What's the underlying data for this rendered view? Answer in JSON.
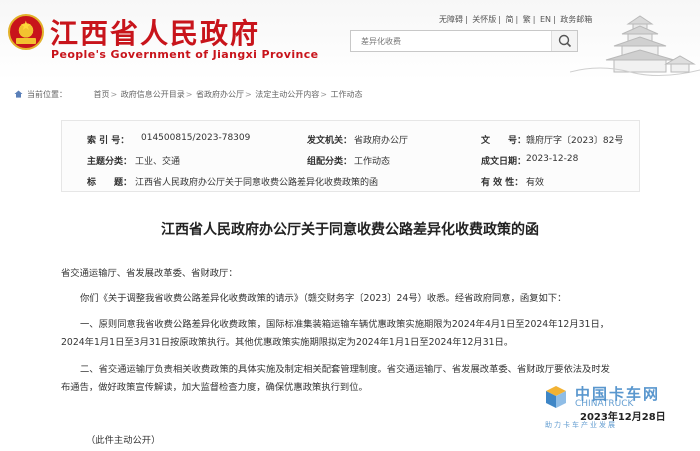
{
  "header": {
    "site_title_cn": "江西省人民政府",
    "site_title_en": "People's Government of Jiangxi Province",
    "top_links": [
      "无障碍",
      "关怀版",
      "简",
      "繁",
      "EN",
      "政务邮箱"
    ],
    "search_placeholder": "差异化收费"
  },
  "breadcrumb": {
    "label": "当前位置：",
    "items": [
      "首页",
      "政府信息公开目录",
      "省政府办公厅",
      "法定主动公开内容",
      "工作动态"
    ]
  },
  "meta": {
    "index_label": "索 引 号：",
    "index_value": "014500815/2023-78309",
    "issuer_label": "发文机关：",
    "issuer_value": "省政府办公厅",
    "docno_label": "文　　号：",
    "docno_value": "赣府厅字〔2023〕82号",
    "topic_label": "主题分类：",
    "topic_value": "工业、交通",
    "category_label": "组配分类：",
    "category_value": "工作动态",
    "date_label": "成文日期：",
    "date_value": "2023-12-28",
    "title_label": "标　　题：",
    "title_value": "江西省人民政府办公厅关于同意收费公路差异化收费政策的函",
    "validity_label": "有 效 性：",
    "validity_value": "有效"
  },
  "doc": {
    "title": "江西省人民政府办公厅关于同意收费公路差异化收费政策的函",
    "addressee": "省交通运输厅、省发展改革委、省财政厅：",
    "p1": "你们《关于调整我省收费公路差异化收费政策的请示》（赣交财务字〔2023〕24号）收悉。经省政府同意，函复如下：",
    "p2_l1": "一、原则同意我省收费公路差异化收费政策，国际标准集装箱运输车辆优惠政策实施期限为2024年4月1日至2024年12月31日，",
    "p2_l2": "2024年1月1日至3月31日按原政策执行。其他优惠政策实施期限拟定为2024年1月1日至2024年12月31日。",
    "p3_l1": "二、省交通运输厅负责相关收费政策的具体实施及制定相关配套管理制度。省交通运输厅、省发展改革委、省财政厅要依法及时发",
    "p3_l2": "布通告，做好政策宣传解读，加大监督检查力度，确保优惠政策执行到位。",
    "closing": "（此件主动公开）"
  },
  "watermark": {
    "cn": "中国卡车网",
    "en": "CHINATRUCK",
    "date": "2023年12月28日",
    "tag": "助力卡车产业发展"
  },
  "colors": {
    "brand_red": "#c8141b",
    "watermark_blue": "#3e86c6"
  }
}
